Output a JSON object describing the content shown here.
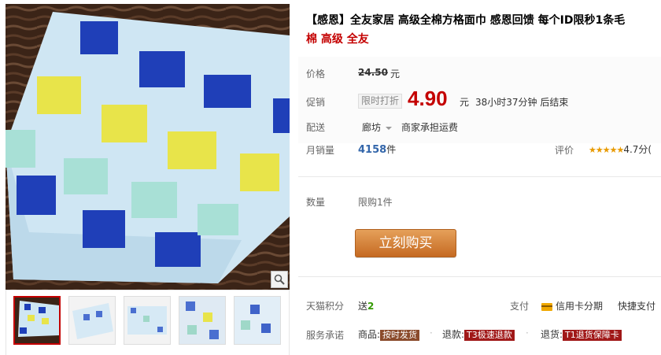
{
  "product": {
    "title_line1": "【感恩】全友家居 高级全棉方格面巾 感恩回馈 每个ID限秒1条毛",
    "title_line2": "棉 高级 全友"
  },
  "price": {
    "label": "价格",
    "original": "24.50",
    "unit": "元"
  },
  "promo": {
    "label": "促销",
    "tag": "限时打折",
    "price": "4.90",
    "unit": "元",
    "countdown": "38小时37分钟 后结束"
  },
  "shipping": {
    "label": "配送",
    "location": "廊坊",
    "note": "商家承担运费"
  },
  "sales": {
    "label": "月销量",
    "count": "4158",
    "unit": "件",
    "rating_label": "评价",
    "stars": "★★★★★",
    "rating": "4.7分("
  },
  "quantity": {
    "label": "数量",
    "limit": "限购1件"
  },
  "buy": {
    "label": "立刻购买"
  },
  "points": {
    "label": "天猫积分",
    "prefix": "送",
    "value": "2"
  },
  "payment": {
    "label": "支付",
    "credit": "信用卡分期",
    "fast": "快捷支付"
  },
  "service": {
    "label": "服务承诺",
    "goods_label": "商品:",
    "goods_badge": "按时发货",
    "refund_label": "退款:",
    "refund_badge": "T3极速退款",
    "return_label": "退货:",
    "return_badge": "T1退货保障卡"
  },
  "colors": {
    "accent_red": "#c40000",
    "buy_button": "#d17e35",
    "points_green": "#339900",
    "sales_blue": "#3366aa"
  },
  "icons": [
    "zoom-icon",
    "dropdown-arrow-icon",
    "credit-card-icon",
    "star-icon"
  ]
}
